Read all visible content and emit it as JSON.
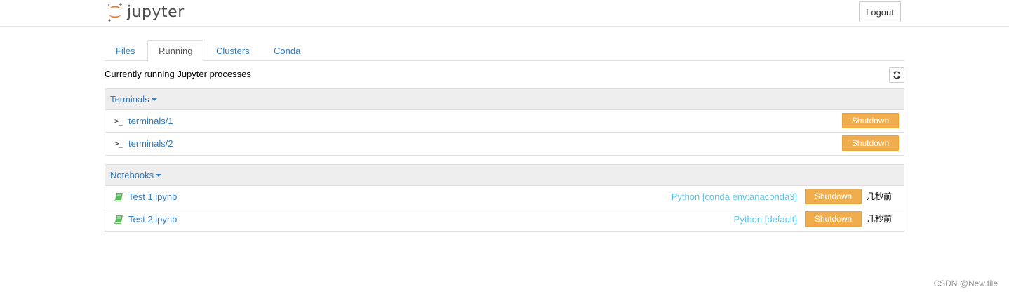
{
  "header": {
    "logo_text": "jupyter",
    "logout_label": "Logout"
  },
  "tabs": [
    {
      "label": "Files",
      "active": false
    },
    {
      "label": "Running",
      "active": true
    },
    {
      "label": "Clusters",
      "active": false
    },
    {
      "label": "Conda",
      "active": false
    }
  ],
  "subtitle": "Currently running Jupyter processes",
  "terminals": {
    "header": "Terminals",
    "items": [
      {
        "icon": ">_",
        "name": "terminals/1",
        "shutdown_label": "Shutdown"
      },
      {
        "icon": ">_",
        "name": "terminals/2",
        "shutdown_label": "Shutdown"
      }
    ]
  },
  "notebooks": {
    "header": "Notebooks",
    "items": [
      {
        "name": "Test 1.ipynb",
        "kernel": "Python [conda env:anaconda3]",
        "shutdown_label": "Shutdown",
        "time": "几秒前"
      },
      {
        "name": "Test 2.ipynb",
        "kernel": "Python [default]",
        "shutdown_label": "Shutdown",
        "time": "几秒前"
      }
    ]
  },
  "watermark": "CSDN @New.file",
  "colors": {
    "link": "#337ab7",
    "warning": "#f0ad4e",
    "info": "#5bc0de",
    "notebook_icon": "#5cb85c",
    "logo_orange": "#f37726"
  },
  "icons": {
    "refresh": "refresh-icon",
    "notebook": "book-icon",
    "terminal": "terminal-icon",
    "logo": "jupyter-logo"
  }
}
